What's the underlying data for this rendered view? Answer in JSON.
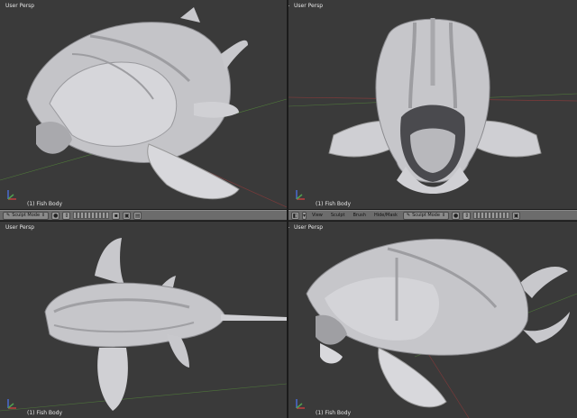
{
  "viewports": {
    "top_left": {
      "view": "User Persp",
      "object": "(1) Fish Body"
    },
    "top_right": {
      "view": "User Persp",
      "object": "(1) Fish Body"
    },
    "bottom_left": {
      "view": "User Persp",
      "object": "(1) Fish Body"
    },
    "bottom_right": {
      "view": "User Persp",
      "object": "(1) Fish Body"
    }
  },
  "header_left": {
    "mode": "Sculpt Mode"
  },
  "header_right": {
    "menus": [
      "View",
      "Sculpt",
      "Brush",
      "Hide/Mask"
    ],
    "mode": "Sculpt Mode"
  },
  "colors": {
    "viewport_bg": "#3a3a3a",
    "header_bg": "#6c6c6c",
    "model": "#c9c9cc",
    "grid_red": "#b03a3a",
    "grid_green": "#5a9a3a"
  },
  "icons": [
    "view-icon",
    "sculpt-mode-icon",
    "shading-icon",
    "pivot-icon",
    "layers-grid",
    "render-icon"
  ]
}
